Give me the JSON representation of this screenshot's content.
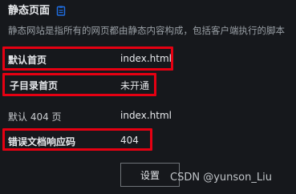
{
  "section": {
    "title": "静态页面",
    "title_icon": "document-icon",
    "description": "静态网站是指所有的网页都由静态内容构成，包括客户端执行的脚本"
  },
  "rows": [
    {
      "label": "默认首页",
      "value": "index.html"
    },
    {
      "label": "子目录首页",
      "value": "未开通"
    },
    {
      "label": "默认 404 页",
      "value": "index.html"
    },
    {
      "label": "错误文档响应码",
      "value": "404"
    }
  ],
  "actions": {
    "settings_label": "设置"
  },
  "watermark": "CSDN @yunson_Liu",
  "colors": {
    "background": "#16181c",
    "highlight_border": "#e60012",
    "accent_icon": "#1f6fe5"
  }
}
